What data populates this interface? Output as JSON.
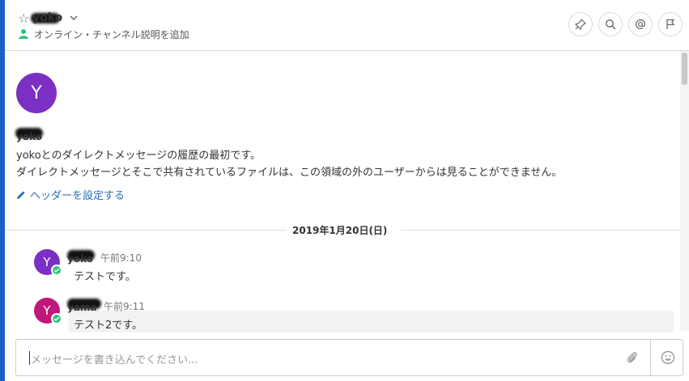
{
  "header": {
    "channel_name": "yoko",
    "status_text": "オンライン・チャンネル説明を追加"
  },
  "intro": {
    "avatar_initial": "Y",
    "display_name": "yoko",
    "line1": "yokoとのダイレクトメッセージの履歴の最初です。",
    "line2": "ダイレクトメッセージとそこで共有されているファイルは、この領域の外のユーザーからは見ることができません。",
    "set_header_link": "ヘッダーを設定する"
  },
  "date_separator": "2019年1月20日(日)",
  "posts": [
    {
      "avatar_initial": "Y",
      "username": "yoko",
      "time": "午前9:10",
      "text": "テストです。"
    },
    {
      "avatar_initial": "Y",
      "username": "yama",
      "time": "午前9:11",
      "text": "テスト2です。"
    }
  ],
  "composer": {
    "placeholder": "メッセージを書き込んでください..."
  },
  "colors": {
    "accent_bar": "#1b5fc6",
    "avatar_yoko": "#7b2fc4",
    "avatar_yama": "#c0177a",
    "online": "#2ec27e",
    "link": "#2a6ebb"
  },
  "icons": [
    "star-icon",
    "chevron-down-icon",
    "online-status-icon",
    "pin-icon",
    "search-icon",
    "mention-icon",
    "flag-icon",
    "pencil-icon",
    "check-icon",
    "attachment-icon",
    "emoji-icon"
  ]
}
